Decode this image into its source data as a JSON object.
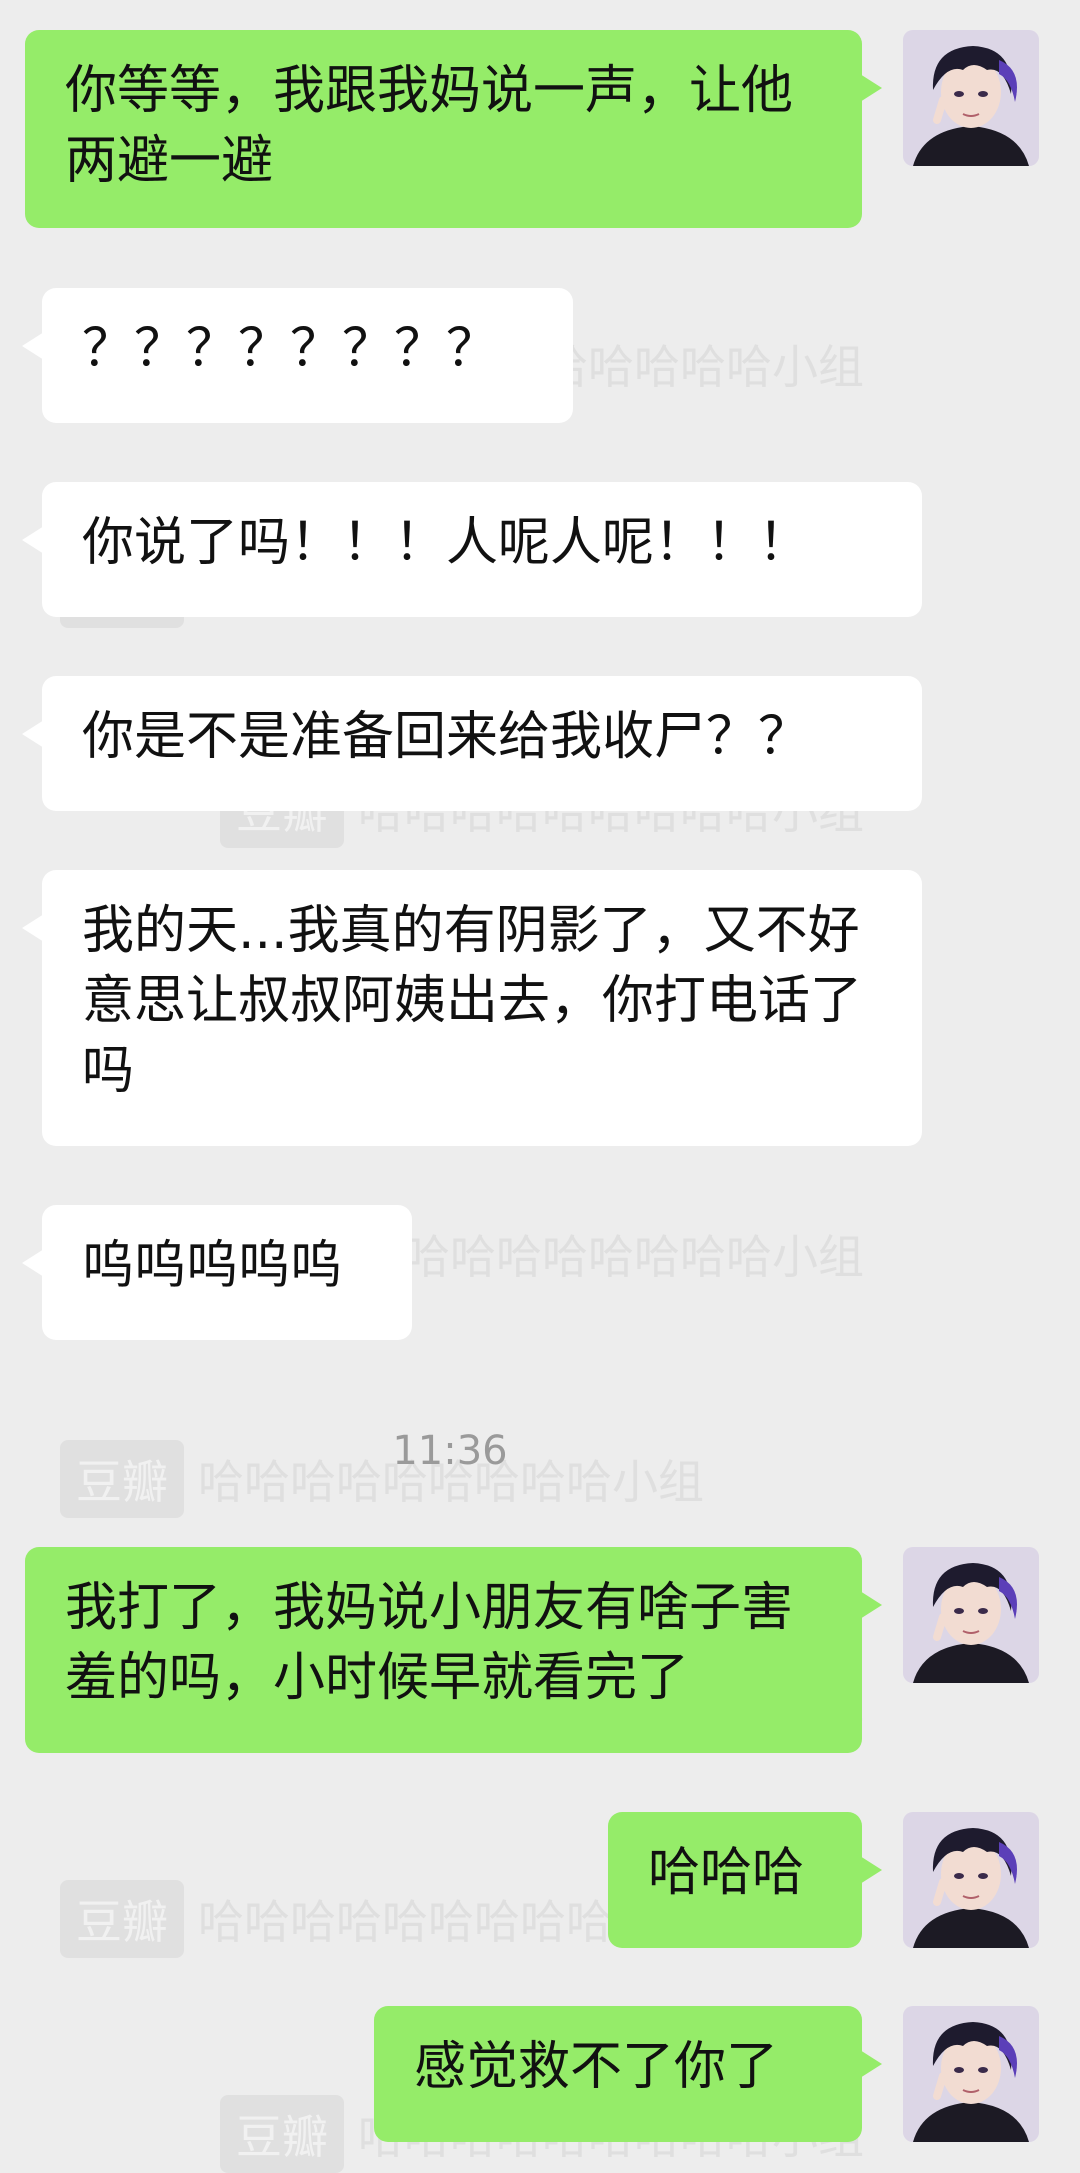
{
  "messages": [
    {
      "side": "out",
      "text": "你等等，我跟我妈说一声，让他两避一避"
    },
    {
      "side": "in",
      "text": "？？？？？？？？"
    },
    {
      "side": "in",
      "text": "你说了吗！！！人呢人呢！！！"
    },
    {
      "side": "in",
      "text": "你是不是准备回来给我收尸？？"
    },
    {
      "side": "in",
      "text": "我的天...我真的有阴影了，又不好意思让叔叔阿姨出去，你打电话了吗"
    },
    {
      "side": "in",
      "text": "呜呜呜呜呜"
    },
    {
      "side": "out",
      "text": "我打了，我妈说小朋友有啥子害羞的吗，小时候早就看完了"
    },
    {
      "side": "out",
      "text": "哈哈哈"
    },
    {
      "side": "out",
      "text": "感觉救不了你了"
    }
  ],
  "timestamp": "11:36",
  "watermark": {
    "brand": "豆瓣",
    "group": "哈哈哈哈哈哈哈哈哈小组"
  },
  "colors": {
    "background": "#ededed",
    "outgoing_bubble": "#95ec69",
    "incoming_bubble": "#ffffff",
    "timestamp": "#9a9a9a"
  },
  "icons": {
    "avatar": "avatar-anime-boy-icon"
  }
}
